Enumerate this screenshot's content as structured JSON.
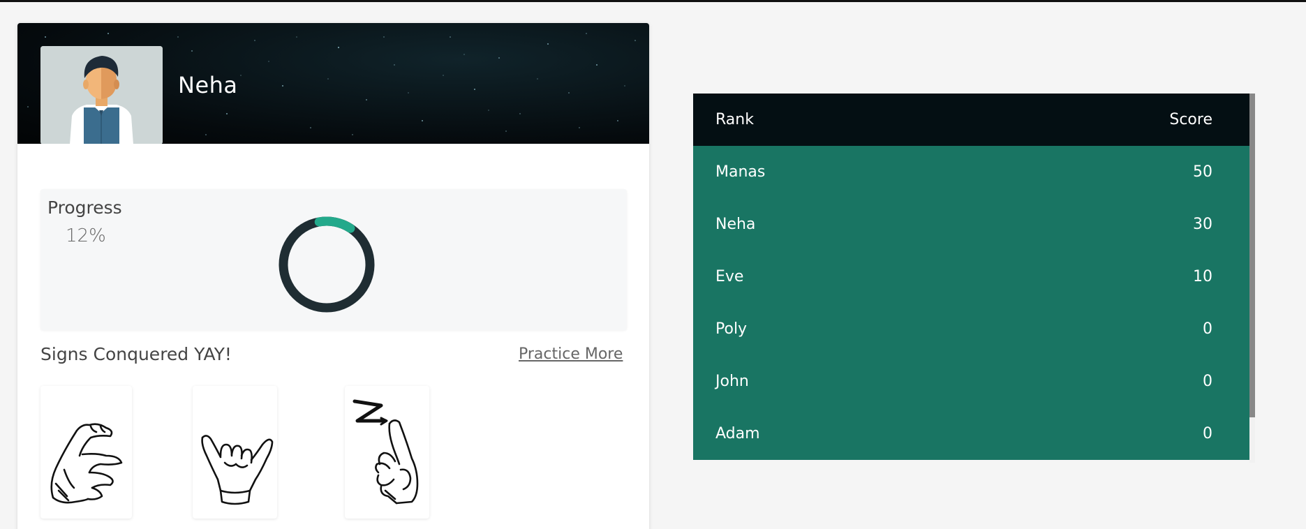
{
  "profile": {
    "name": "Neha"
  },
  "progress": {
    "title": "Progress",
    "value_text": "12%",
    "fraction": 0.12,
    "track_color": "#1f2d33",
    "fill_color": "#23a98b"
  },
  "signs": {
    "title": "Signs Conquered YAY!",
    "practice_label": "Practice More",
    "items": [
      {
        "icon": "sign-c-icon"
      },
      {
        "icon": "sign-y-icon"
      },
      {
        "icon": "sign-z-icon"
      }
    ]
  },
  "leaderboard": {
    "header": {
      "rank": "Rank",
      "score": "Score"
    },
    "rows": [
      {
        "name": "Manas",
        "score": "50"
      },
      {
        "name": "Neha",
        "score": "30"
      },
      {
        "name": "Eve",
        "score": "10"
      },
      {
        "name": "Poly",
        "score": "0"
      },
      {
        "name": "John",
        "score": "0"
      },
      {
        "name": "Adam",
        "score": "0"
      }
    ],
    "colors": {
      "header": "#040f13",
      "row": "#197563",
      "text": "#ffffff"
    }
  }
}
